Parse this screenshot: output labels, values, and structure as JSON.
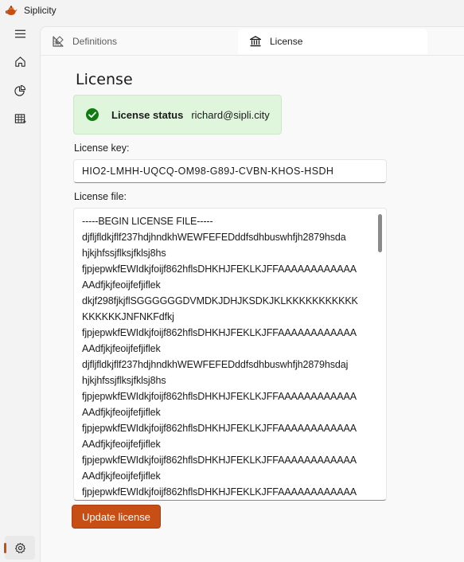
{
  "app": {
    "title": "Siplicity",
    "accent": "#c74e14"
  },
  "nav": {
    "items": [
      {
        "icon": "hamburger-menu-icon"
      },
      {
        "icon": "home-icon"
      },
      {
        "icon": "pie-chart-icon"
      },
      {
        "icon": "table-icon"
      },
      {
        "icon": "settings-gear-icon",
        "selected": true
      }
    ]
  },
  "tabs": [
    {
      "label": "Definitions",
      "icon": "ruler-triangle-icon"
    },
    {
      "label": "License",
      "icon": "bank-building-icon",
      "selected": true
    }
  ],
  "page": {
    "title": "License",
    "status": {
      "label": "License status",
      "value": "richard@sipli.city",
      "icon": "check-circle-icon",
      "color": "#107c10"
    },
    "key_label": "License key:",
    "key_value": "HIO2-LMHH-UQCQ-OM98-G89J-CVBN-KHOS-HSDH",
    "file_label": "License file:",
    "file_lines": [
      "-----BEGIN LICENSE FILE-----",
      "djfljfldkjflf237hdjhndkhWEWFEFEDddfsdhbuswhfjh2879hsda",
      "hjkjhfssjflksjfklsj8hs",
      "fjpjepwkfEWIdkjfoijf862hflsDHKHJFEKLKJFFAAAAAAAAAAAA",
      "AAdfjkjfeoijfefjiflek",
      "dkjf298fjkjflSGGGGGGDVMDKJDHJKSDKJKLKKKKKKKKKKK",
      "KKKKKKJNFNKFdfkj",
      "fjpjepwkfEWIdkjfoijf862hflsDHKHJFEKLKJFFAAAAAAAAAAAA",
      "AAdfjkjfeoijfefjiflek",
      "djfljfldkjflf237hdjhndkhWEWFEFEDddfsdhbuswhfjh2879hsdaj",
      "hjkjhfssjflksjfklsj8hs",
      "fjpjepwkfEWIdkjfoijf862hflsDHKHJFEKLKJFFAAAAAAAAAAAA",
      "AAdfjkjfeoijfefjiflek",
      "fjpjepwkfEWIdkjfoijf862hflsDHKHJFEKLKJFFAAAAAAAAAAAA",
      "AAdfjkjfeoijfefjiflek",
      "fjpjepwkfEWIdkjfoijf862hflsDHKHJFEKLKJFFAAAAAAAAAAAA",
      "AAdfjkjfeoijfefjiflek",
      "fjpjepwkfEWIdkjfoijf862hflsDHKHJFEKLKJFFAAAAAAAAAAAA"
    ],
    "update_button": "Update license"
  }
}
